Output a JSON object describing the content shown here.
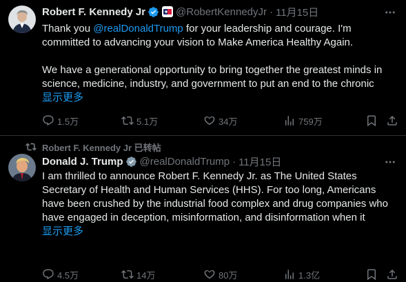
{
  "tweets": [
    {
      "name": "Robert F. Kennedy Jr",
      "handle": "@RobertKennedyJr",
      "separator": "·",
      "date": "11月15日",
      "text_parts": [
        "Thank you ",
        "@realDonaldTrump",
        " for your leadership and courage. I'm committed to advancing your vision to Make America Healthy Again.",
        "We have a generational opportunity to bring together the greatest minds in science, medicine, industry, and government to put an end to the chronic"
      ],
      "show_more": "显示更多",
      "stats": {
        "replies": "1.5万",
        "reposts": "5.1万",
        "likes": "34万",
        "views": "759万"
      }
    },
    {
      "repost_label": "Robert F. Kennedy Jr 已转帖",
      "name": "Donald J. Trump",
      "handle": "@realDonaldTrump",
      "separator": "·",
      "date": "11月15日",
      "text": "I am thrilled to announce Robert F. Kennedy Jr. as The United States Secretary of Health and Human Services (HHS). For too long, Americans have been crushed by the industrial food complex and drug companies who have engaged in deception, misinformation, and disinformation when it",
      "show_more": "显示更多",
      "stats": {
        "replies": "4.5万",
        "reposts": "14万",
        "likes": "80万",
        "views": "1.3亿"
      }
    }
  ],
  "colors": {
    "background": "#000000",
    "text": "#e7e9ea",
    "secondary": "#71767b",
    "link": "#1d9bf0",
    "verified": "#1d9bf0",
    "divider": "#2f3336"
  },
  "icons": [
    "more-icon",
    "verified-badge-icon",
    "affiliation-badge-icon",
    "reply-icon",
    "repost-icon",
    "like-icon",
    "views-icon",
    "bookmark-icon",
    "share-icon"
  ]
}
